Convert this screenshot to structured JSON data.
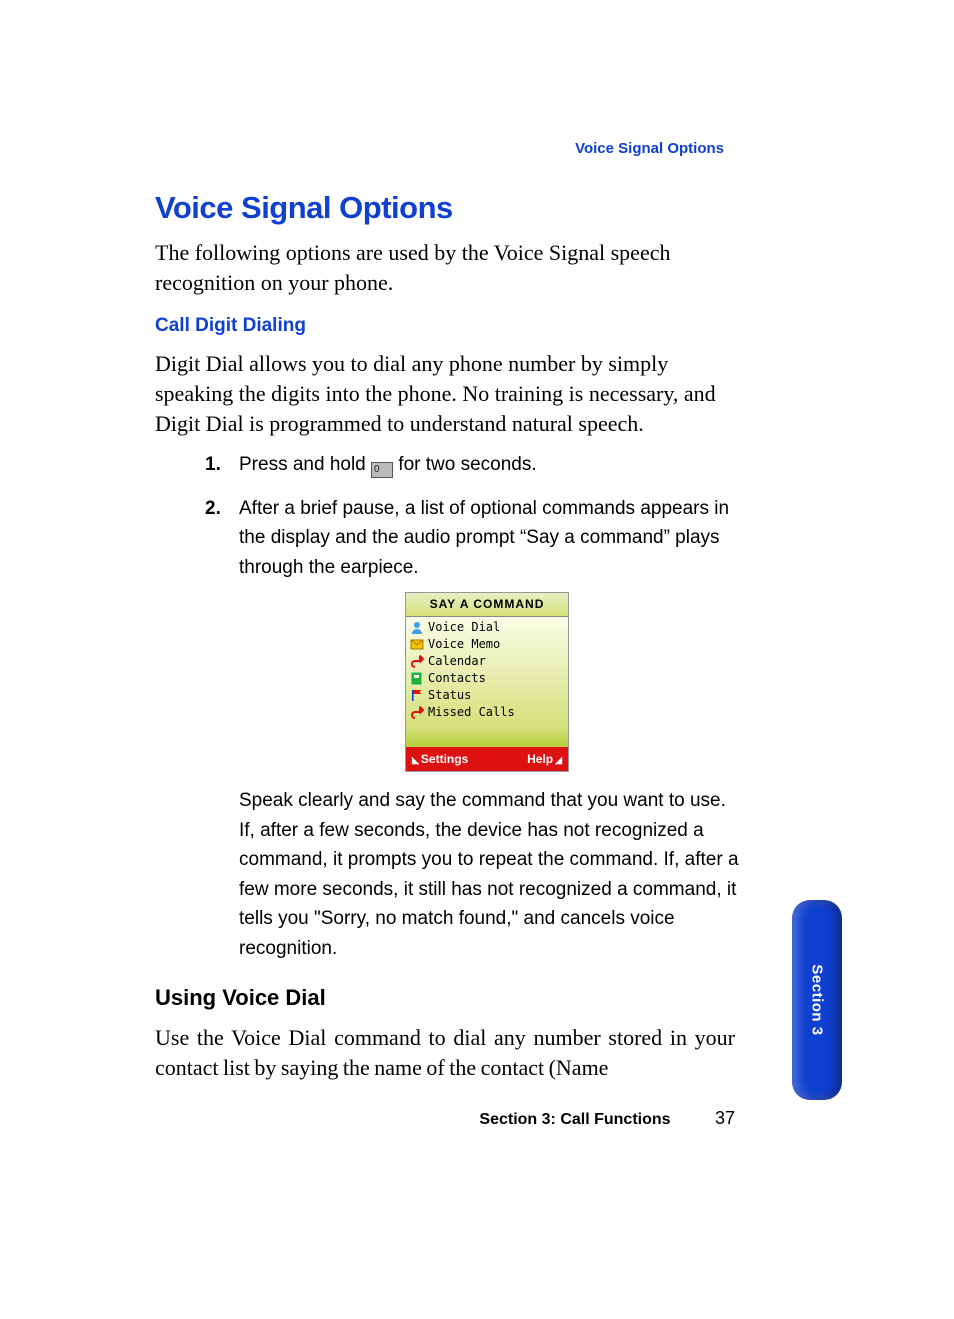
{
  "running_head": "Voice Signal Options",
  "title": "Voice Signal Options",
  "intro": "The following options are used by the Voice Signal speech recognition on your phone.",
  "sub1": "Call Digit Dialing",
  "p1": "Digit Dial allows you to dial any phone number by simply speaking the digits into the phone. No training is necessary, and Digit Dial is programmed to understand natural speech.",
  "steps": {
    "s1_num": "1.",
    "s1_a": "Press and hold ",
    "s1_key": "0",
    "s1_b": " for two seconds.",
    "s2_num": "2.",
    "s2": "After a brief pause, a list of optional commands appears in the display and the audio prompt “Say a command” plays through the earpiece."
  },
  "phone": {
    "title": "SAY A COMMAND",
    "items": [
      "Voice Dial",
      "Voice Memo",
      "Calendar",
      "Contacts",
      "Status",
      "Missed Calls"
    ],
    "left": "Settings",
    "right": "Help"
  },
  "post": "Speak clearly and say the command that you want to use. If, after a few seconds, the device has not recognized a command, it prompts you to repeat the command. If, after a few more seconds, it still has not recognized a command, it tells you \"Sorry, no match found,\" and cancels voice recognition.",
  "sub2": "Using Voice Dial",
  "p2": "Use the Voice Dial command to dial any number stored in your contact list by saying the name of the contact (Name",
  "tab": "Section 3",
  "footer_section": "Section 3: Call Functions",
  "footer_page": "37"
}
